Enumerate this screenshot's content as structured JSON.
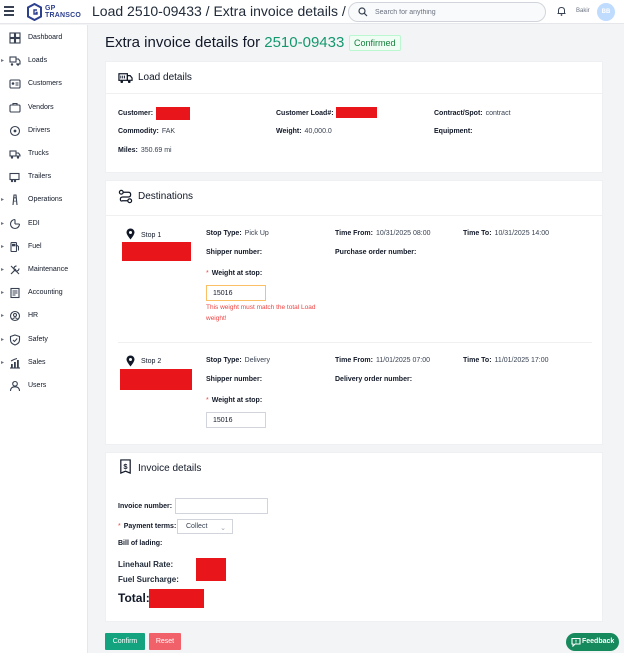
{
  "app": {
    "brand_line1": "GP",
    "brand_line2": "TRANSCO"
  },
  "header": {
    "breadcrumb": "Load 2510-09433 / Extra invoice details /",
    "search_placeholder": "Search for anything",
    "user_name": "Bakir",
    "avatar_initials": "BB"
  },
  "sidebar": {
    "items": [
      {
        "label": "Dashboard",
        "icon": "dashboard-icon",
        "expandable": false
      },
      {
        "label": "Loads",
        "icon": "loads-icon",
        "expandable": true
      },
      {
        "label": "Customers",
        "icon": "customers-icon",
        "expandable": false
      },
      {
        "label": "Vendors",
        "icon": "vendors-icon",
        "expandable": false
      },
      {
        "label": "Drivers",
        "icon": "drivers-icon",
        "expandable": false
      },
      {
        "label": "Trucks",
        "icon": "trucks-icon",
        "expandable": false
      },
      {
        "label": "Trailers",
        "icon": "trailers-icon",
        "expandable": false
      },
      {
        "label": "Operations",
        "icon": "operations-icon",
        "expandable": true
      },
      {
        "label": "EDI",
        "icon": "edi-icon",
        "expandable": true
      },
      {
        "label": "Fuel",
        "icon": "fuel-icon",
        "expandable": true
      },
      {
        "label": "Maintenance",
        "icon": "maintenance-icon",
        "expandable": true
      },
      {
        "label": "Accounting",
        "icon": "accounting-icon",
        "expandable": true
      },
      {
        "label": "HR",
        "icon": "hr-icon",
        "expandable": true
      },
      {
        "label": "Safety",
        "icon": "safety-icon",
        "expandable": true
      },
      {
        "label": "Sales",
        "icon": "sales-icon",
        "expandable": true
      },
      {
        "label": "Users",
        "icon": "users-icon",
        "expandable": false
      }
    ]
  },
  "page": {
    "title": "Extra invoice details for",
    "load_id": "2510-09433",
    "status": "Confirmed"
  },
  "load_details": {
    "title": "Load details",
    "customer_label": "Customer",
    "customer_load_label": "Customer Load#",
    "contract_spot_label": "Contract/Spot",
    "contract_spot_value": "contract",
    "commodity_label": "Commodity",
    "commodity_value": "FAK",
    "weight_label": "Weight",
    "weight_value": "40,000.0",
    "equipment_label": "Equipment",
    "equipment_value": "",
    "miles_label": "Miles",
    "miles_value": "350.69 mi"
  },
  "destinations": {
    "title": "Destinations",
    "stops": [
      {
        "name": "Stop 1",
        "stop_type_label": "Stop Type",
        "stop_type_value": "Pick Up",
        "time_from_label": "Time From",
        "time_from_value": "10/31/2025 08:00",
        "time_to_label": "Time To",
        "time_to_value": "10/31/2025 14:00",
        "shipper_label": "Shipper number",
        "order_label": "Purchase order number",
        "weight_label": "Weight at stop",
        "weight_value": "15016",
        "error": "This weight must match the total Load weight!"
      },
      {
        "name": "Stop 2",
        "stop_type_label": "Stop Type",
        "stop_type_value": "Delivery",
        "time_from_label": "Time From",
        "time_from_value": "11/01/2025 07:00",
        "time_to_label": "Time To",
        "time_to_value": "11/01/2025 17:00",
        "shipper_label": "Shipper number",
        "order_label": "Delivery order number",
        "weight_label": "Weight at stop",
        "weight_value": "15016"
      }
    ]
  },
  "invoice": {
    "title": "Invoice details",
    "invoice_number_label": "Invoice number:",
    "invoice_number_value": "",
    "payment_terms_label": "Payment terms",
    "payment_terms_value": "Collect",
    "bill_of_lading_label": "Bill of lading",
    "linehaul_label": "Linehaul Rate:",
    "fuel_surcharge_label": "Fuel Surcharge:",
    "total_label": "Total:"
  },
  "actions": {
    "confirm": "Confirm",
    "reset": "Reset",
    "feedback": "Feedback"
  },
  "colors": {
    "accent": "#14986f",
    "redaction": "#e8161b",
    "error": "#ef4444",
    "reset": "#f1616a",
    "brand": "#2d3f8f"
  }
}
